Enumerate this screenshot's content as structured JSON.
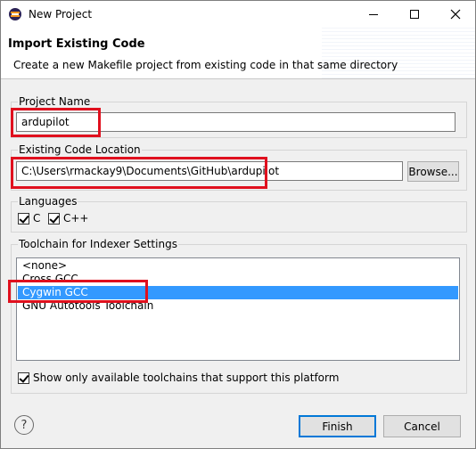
{
  "window": {
    "title": "New Project"
  },
  "banner": {
    "title": "Import Existing Code",
    "description": "Create a new Makefile project from existing code in that same directory"
  },
  "project_name": {
    "label": "Project Name",
    "value": "ardupilot"
  },
  "code_location": {
    "label": "Existing Code Location",
    "value": "C:\\Users\\rmackay9\\Documents\\GitHub\\ardupilot",
    "browse_label": "Browse..."
  },
  "languages": {
    "label": "Languages",
    "items": [
      {
        "label": "C",
        "checked": true
      },
      {
        "label": "C++",
        "checked": true
      }
    ]
  },
  "toolchain": {
    "label": "Toolchain for Indexer Settings",
    "items": [
      {
        "label": "<none>",
        "selected": false
      },
      {
        "label": "Cross GCC",
        "selected": false
      },
      {
        "label": "Cygwin GCC",
        "selected": true
      },
      {
        "label": "GNU Autotools Toolchain",
        "selected": false
      }
    ],
    "filter_checkbox": {
      "label": "Show only available toolchains that support this platform",
      "checked": true
    }
  },
  "footer": {
    "help_label": "?",
    "finish_label": "Finish",
    "cancel_label": "Cancel"
  },
  "colors": {
    "highlight": "#e0101e",
    "selection": "#3399ff"
  },
  "icons": {
    "app": "eclipse-icon",
    "minimize": "minimize-icon",
    "maximize": "maximize-icon",
    "close": "close-icon",
    "help": "help-icon"
  }
}
